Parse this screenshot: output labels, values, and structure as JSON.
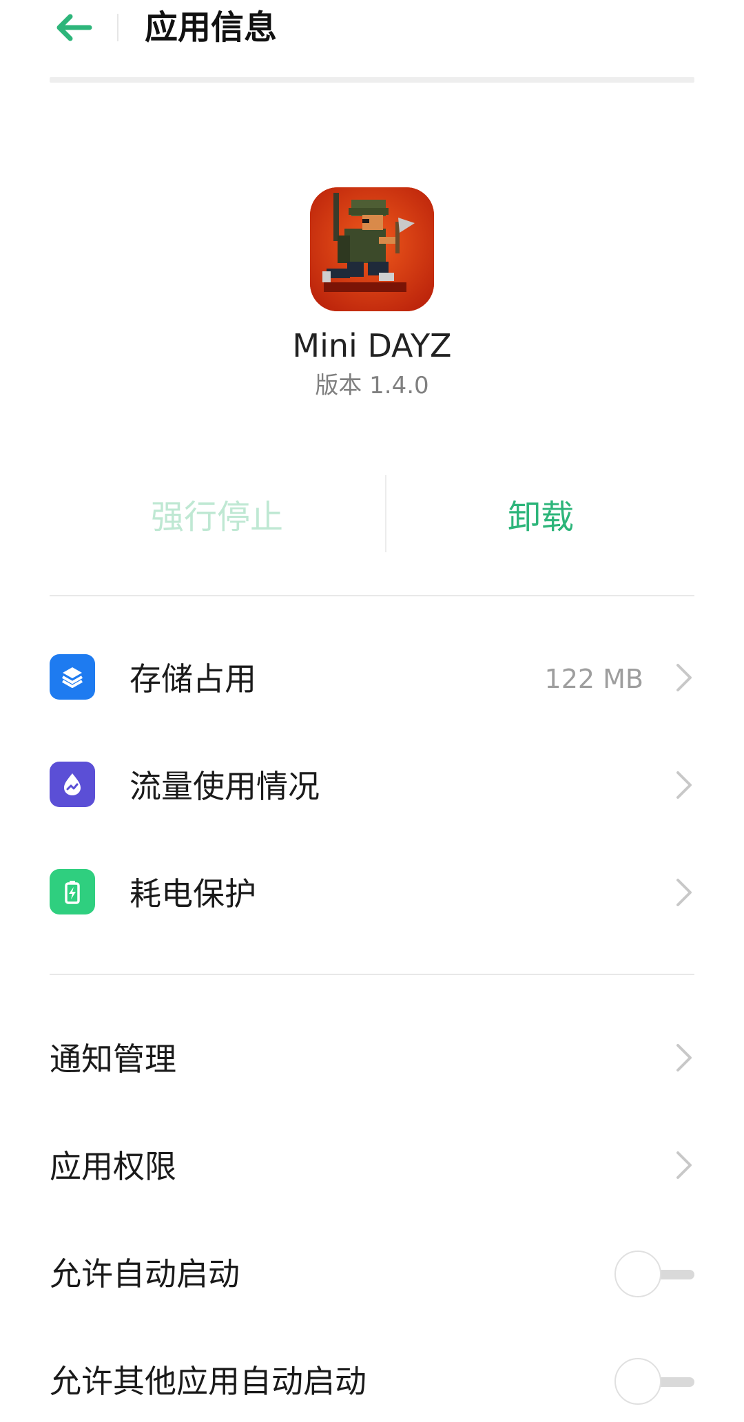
{
  "header": {
    "title": "应用信息",
    "accent_color": "#2db57a",
    "back_icon": "arrow-left-icon"
  },
  "app": {
    "name": "Mini DAYZ",
    "version": "版本 1.4.0",
    "icon": "mini-dayz-app-icon"
  },
  "actions": {
    "force_stop": "强行停止",
    "force_stop_enabled": false,
    "uninstall": "卸载"
  },
  "usage_items": [
    {
      "label": "存储占用",
      "value": "122 MB",
      "icon": "layers-icon",
      "icon_color": "#1e7bf0"
    },
    {
      "label": "流量使用情况",
      "value": "",
      "icon": "data-usage-icon",
      "icon_color": "#5b4fd6"
    },
    {
      "label": "耗电保护",
      "value": "",
      "icon": "battery-icon",
      "icon_color": "#2fcf7f"
    }
  ],
  "settings": [
    {
      "label": "通知管理"
    },
    {
      "label": "应用权限"
    }
  ],
  "toggles": [
    {
      "label": "允许自动启动",
      "on": false
    },
    {
      "label": "允许其他应用自动启动",
      "on": false
    }
  ]
}
